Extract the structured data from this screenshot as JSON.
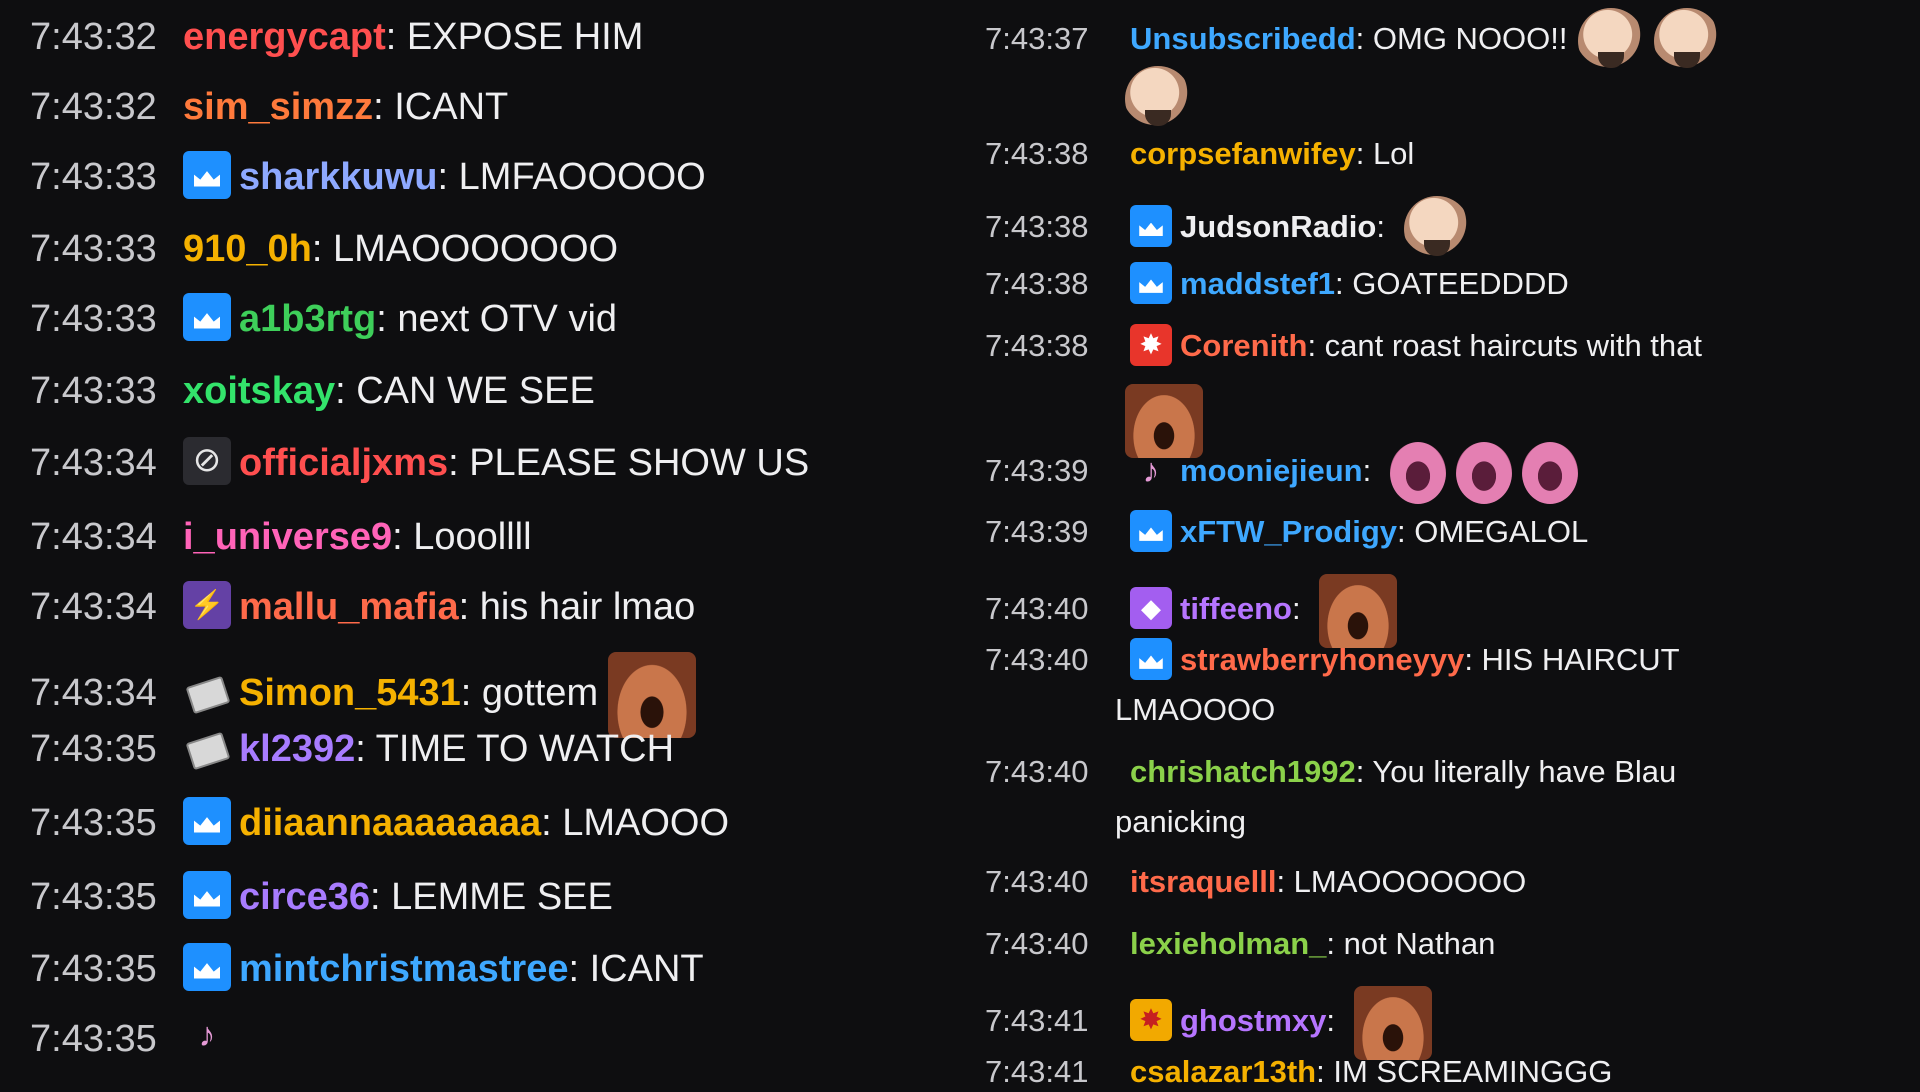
{
  "left_messages": [
    {
      "time": "7:43:32",
      "user": "energycapt",
      "color": "#ff4f4f",
      "text": "EXPOSE HIM",
      "badge": null,
      "emote": null
    },
    {
      "time": "7:43:32",
      "user": "sim_simzz",
      "color": "#ff7a3c",
      "text": "ICANT",
      "badge": null,
      "emote": null
    },
    {
      "time": "7:43:33",
      "user": "sharkkuwu",
      "color": "#8ea9ff",
      "text": "LMFAOOOOO",
      "badge": "crown-icon",
      "emote": null
    },
    {
      "time": "7:43:33",
      "user": "910_0h",
      "color": "#f5b100",
      "text": "LMAOOOOOOO",
      "badge": null,
      "emote": null
    },
    {
      "time": "7:43:33",
      "user": "a1b3rtg",
      "color": "#3ecf5a",
      "text": "next OTV vid",
      "badge": "crown-icon",
      "emote": null
    },
    {
      "time": "7:43:33",
      "user": "xoitskay",
      "color": "#33e36b",
      "text": "CAN WE SEE",
      "badge": null,
      "emote": null
    },
    {
      "time": "7:43:34",
      "user": "officialjxms",
      "color": "#ff4f4f",
      "text": "PLEASE SHOW US",
      "badge": "no-display-icon",
      "emote": null
    },
    {
      "time": "7:43:34",
      "user": "i_universe9",
      "color": "#ff63b8",
      "text": "Loooll​ll",
      "badge": null,
      "emote": null
    },
    {
      "time": "7:43:34",
      "user": "mallu_mafia",
      "color": "#ff6a4a",
      "text": "his hair lmao",
      "badge": "glitch-icon",
      "emote": null
    },
    {
      "time": "7:43:34",
      "user": "Simon_5431",
      "color": "#f5b100",
      "text": "gottem",
      "badge": "gift-icon",
      "emote": "face"
    },
    {
      "time": "7:43:35",
      "user": "kl2392",
      "color": "#a87cff",
      "text": "TIME TO WATCH",
      "badge": "gift-icon",
      "emote": null
    },
    {
      "time": "7:43:35",
      "user": "diiaannaaaaaaaa",
      "color": "#f5b100",
      "text": "LMAOOO",
      "badge": "crown-icon",
      "emote": null
    },
    {
      "time": "7:43:35",
      "user": "circe36",
      "color": "#a87cff",
      "text": "LEMME SEE",
      "badge": "crown-icon",
      "emote": null
    },
    {
      "time": "7:43:35",
      "user": "mintchristmastree",
      "color": "#3ea8ff",
      "text": "ICANT",
      "badge": "crown-icon",
      "emote": null
    },
    {
      "time": "7:43:35",
      "user": "",
      "color": "#efeff1",
      "text": "",
      "badge": "note-icon",
      "emote": null
    }
  ],
  "right_messages": [
    {
      "time": "7:43:37",
      "user": "Unsubscribedd",
      "color": "#3ea8ff",
      "text": "OMG NOOO!!",
      "badge": null,
      "emote": "bald",
      "cont": ""
    },
    {
      "time": "7:43:38",
      "user": "corpsefanwifey",
      "color": "#f5b100",
      "text": "Lol",
      "badge": null,
      "emote": null,
      "cont": ""
    },
    {
      "time": "7:43:38",
      "user": "JudsonRadio",
      "color": "#efeff1",
      "text": "",
      "badge": "crown-icon",
      "emote": "bald",
      "cont": ""
    },
    {
      "time": "7:43:38",
      "user": "maddstef1",
      "color": "#3ea8ff",
      "text": "GOATEEDDDD",
      "badge": "crown-icon",
      "emote": null,
      "cont": ""
    },
    {
      "time": "7:43:38",
      "user": "Corenith",
      "color": "#ff6a4a",
      "text": "cant roast haircuts with that",
      "badge": "red-icon",
      "emote": null,
      "cont": ""
    },
    {
      "time": "7:43:39",
      "user": "mooniejieun",
      "color": "#3ea8ff",
      "text": "",
      "badge": "note-icon",
      "emote": "mouth",
      "cont": ""
    },
    {
      "time": "7:43:39",
      "user": "xFTW_Prodigy",
      "color": "#3ea8ff",
      "text": "OMEGALOL",
      "badge": "crown-icon",
      "emote": null,
      "cont": ""
    },
    {
      "time": "7:43:40",
      "user": "tiffeeno",
      "color": "#b675ff",
      "text": "",
      "badge": "purple-icon",
      "emote": "face",
      "cont": ""
    },
    {
      "time": "7:43:40",
      "user": "strawberryhoneyyy",
      "color": "#ff6a4a",
      "text": "HIS HAIRCUT",
      "badge": "crown-icon",
      "emote": null,
      "cont": "LMAOOOO"
    },
    {
      "time": "7:43:40",
      "user": "chrishatch1992",
      "color": "#8bd14a",
      "text": "You literally have Blau",
      "badge": null,
      "emote": null,
      "cont": "panicking"
    },
    {
      "time": "7:43:40",
      "user": "itsraquelll",
      "color": "#ff6a4a",
      "text": "LMAOOOOOOO",
      "badge": null,
      "emote": null,
      "cont": ""
    },
    {
      "time": "7:43:40",
      "user": "lexieholman_",
      "color": "#8bd14a",
      "text": "not Nathan",
      "badge": null,
      "emote": null,
      "cont": ""
    },
    {
      "time": "7:43:41",
      "user": "ghostmxy",
      "color": "#b675ff",
      "text": "",
      "badge": "orange-icon",
      "emote": "face",
      "cont": ""
    },
    {
      "time": "7:43:41",
      "user": "csalazar13th",
      "color": "#f5b100",
      "text": "IM SCREAMINGGG",
      "badge": null,
      "emote": null,
      "cont": ""
    }
  ]
}
